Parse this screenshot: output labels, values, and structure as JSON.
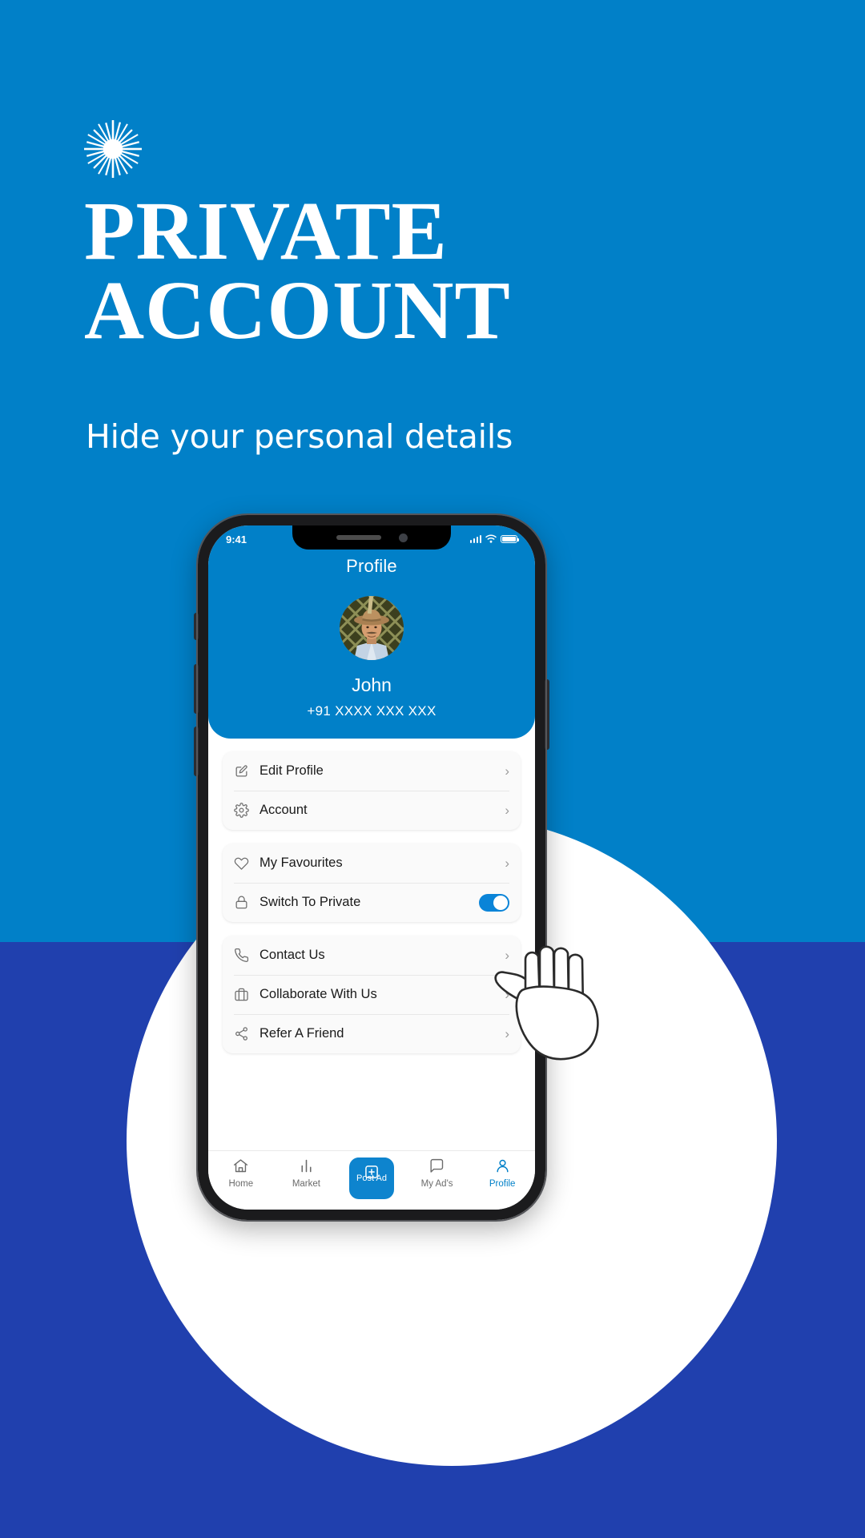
{
  "theme": {
    "brand_blue": "#0180c8",
    "deep_blue": "#2040ae",
    "white": "#ffffff",
    "accent_toggle": "#0a84d8"
  },
  "hero": {
    "badge_icon": "starburst-icon",
    "title_line1": "PRIVATE",
    "title_line2": "ACCOUNT",
    "subtitle": "Hide your personal details"
  },
  "phone": {
    "status_bar": {
      "time": "9:41",
      "signal_icon": "cellular-signal-icon",
      "wifi_icon": "wifi-icon",
      "battery_icon": "battery-full-icon"
    },
    "profile": {
      "title": "Profile",
      "avatar_alt": "user-avatar",
      "name": "John",
      "phone_number": "+91 XXXX XXX XXX"
    },
    "menu_groups": [
      {
        "items": [
          {
            "label": "Edit Profile",
            "icon": "edit-square-icon",
            "trailing": "chevron"
          },
          {
            "label": "Account",
            "icon": "gear-icon",
            "trailing": "chevron"
          }
        ]
      },
      {
        "items": [
          {
            "label": "My Favourites",
            "icon": "heart-icon",
            "trailing": "chevron"
          },
          {
            "label": "Switch To Private",
            "icon": "lock-icon",
            "trailing": "toggle",
            "toggle_on": true
          }
        ]
      },
      {
        "items": [
          {
            "label": "Contact Us",
            "icon": "phone-icon",
            "trailing": "chevron"
          },
          {
            "label": "Collaborate With Us",
            "icon": "briefcase-icon",
            "trailing": "chevron"
          },
          {
            "label": "Refer A Friend",
            "icon": "share-icon",
            "trailing": "chevron"
          }
        ]
      }
    ],
    "bottom_nav": [
      {
        "label": "Home",
        "icon": "home-icon",
        "active": false,
        "primary": false
      },
      {
        "label": "Market",
        "icon": "chart-bars-icon",
        "active": false,
        "primary": false
      },
      {
        "label": "Post Ad",
        "icon": "plus-square-icon",
        "active": false,
        "primary": true
      },
      {
        "label": "My Ad's",
        "icon": "chat-bubble-icon",
        "active": false,
        "primary": false
      },
      {
        "label": "Profile",
        "icon": "person-icon",
        "active": true,
        "primary": false
      }
    ]
  },
  "cursor": {
    "icon": "pointing-hand-icon"
  }
}
